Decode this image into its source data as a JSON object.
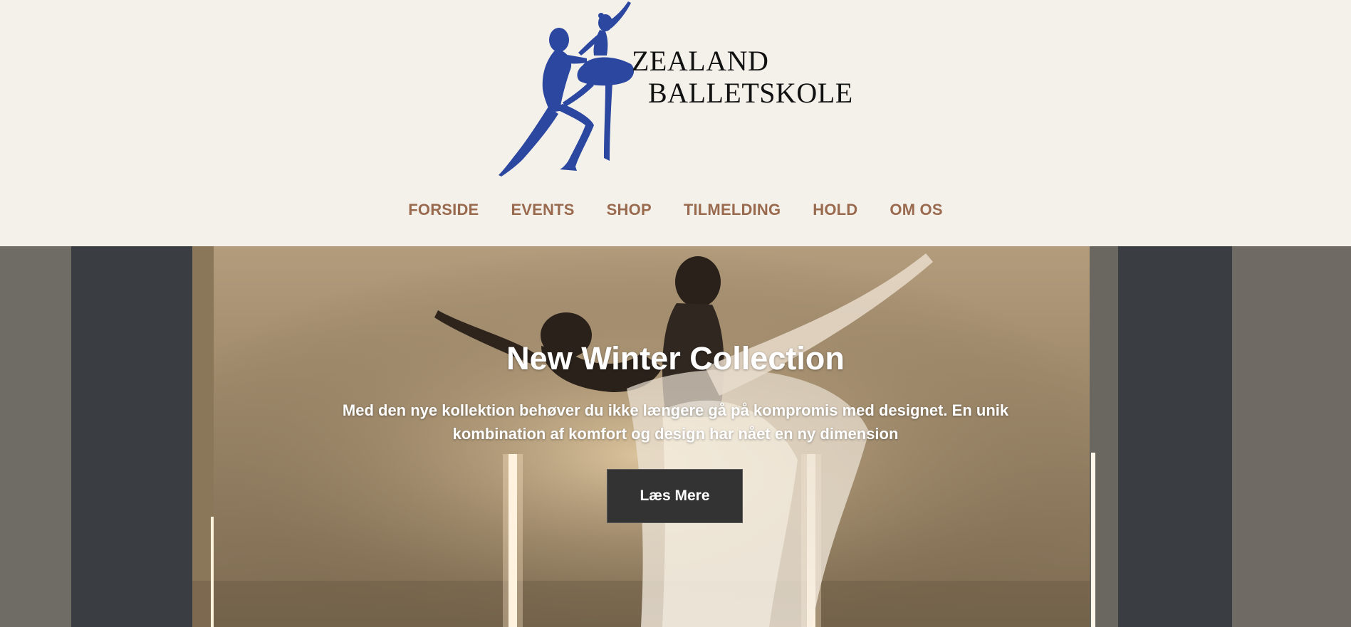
{
  "brand": {
    "line1": "ZEALAND",
    "line2": "BALLETSKOLE",
    "logo_color": "#2b47a0",
    "logo_icon": "ballet-dancers-silhouette-icon"
  },
  "nav": {
    "items": [
      {
        "label": "FORSIDE"
      },
      {
        "label": "EVENTS"
      },
      {
        "label": "SHOP"
      },
      {
        "label": "TILMELDING"
      },
      {
        "label": "HOLD"
      },
      {
        "label": "OM OS"
      }
    ],
    "color": "#9a6a4f"
  },
  "hero": {
    "title": "New Winter Collection",
    "text": "Med den nye kollektion behøver du ikke længere gå på kompromis med designet. En unik kombination af komfort og design har nået en ny dimension",
    "button_label": "Læs Mere"
  },
  "colors": {
    "page_bg": "#f4f1eb",
    "button_bg": "#333333"
  }
}
